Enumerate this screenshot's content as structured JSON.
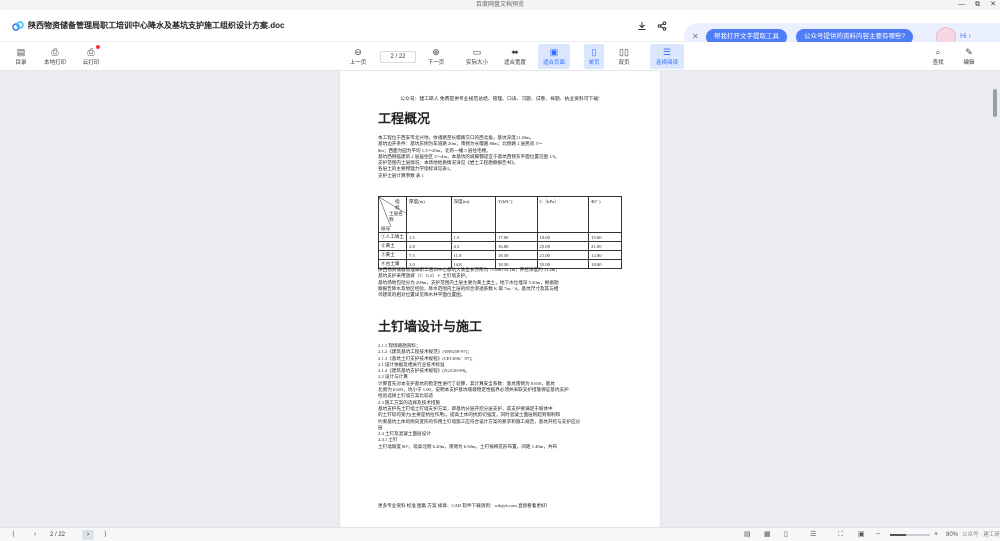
{
  "window": {
    "title": "百度网盘文档预览",
    "controls": [
      "—",
      "⧉",
      "✕"
    ]
  },
  "header": {
    "doc_title": "陕西物资储备管理局职工培训中心降水及基坑支护施工组织设计方案.doc",
    "assistant": {
      "pill1": "帮我打开文字提取工具",
      "pill2": "公众号提供的资料内容主要有哪些?",
      "hi": "Hi ›"
    }
  },
  "toolbar": {
    "catalog": "目录",
    "local_print": "本地打印",
    "cloud_print": "云打印",
    "prev_page": "上一页",
    "page_indicator": "2 / 22",
    "next_page": "下一页",
    "actual_size": "实际大小",
    "fit_width": "适合宽度",
    "fit_page": "适合页面",
    "single_page": "单页",
    "double_page": "双页",
    "continuous": "连续阅读",
    "find": "查找",
    "edit": "编辑"
  },
  "document": {
    "header_note": "公众号：建工研人  免费提供专业规范总结、管理、口诀、习题、试卷、样题、执业资料可下载!",
    "section1_title": "工程概况",
    "section1_paras": [
      "本工程位于西安市北兴地，依诸路至长缨路交口的西北角，基坑深度11.20m。",
      "基坑边开条件：基坑东侧为车道路 20m；南侧为长缨路 80m；北侧路 2 层民房 5～",
      "8m；西面为园为平均 1.5～20m，北有一幢 5 层住宅楼。",
      "基坑西侧临建筑 2 层居住区 3～4m，本基坑的坡脚都适宜于基坑西侧东平面位置见图 1/5。",
      "支护范围内土层情况：本场地地质情况详见《岩土工程勘察报告书》。",
      "各层土的主要物理力学指标详见表1。",
      "支护土层计算参数 表 1"
    ],
    "table": {
      "header": [
        "层号",
        "厚度(m)",
        "深度(m)",
        "Y(kN/  )",
        "C（kPa）",
        "Φ(°  )"
      ],
      "header_diag_top": "指标",
      "header_diag_mid": "土层名称",
      "rows": [
        [
          "①人工填土",
          "1.5",
          "1.5",
          "17.00",
          "10.00",
          "15.00"
        ],
        [
          "②黄土",
          "2.8",
          "4.3",
          "16.80",
          "25.00",
          "21.00"
        ],
        [
          "③黄土",
          "7.5",
          "11.8",
          "18.50",
          "21.00",
          "12.00"
        ],
        [
          "④古土壤",
          "3.0",
          "14.8",
          "18.50",
          "35.00",
          "18.00"
        ]
      ]
    },
    "after_table_paras": [
      "陕西物资储备管理局职工培训中心基坑大致呈长方形为 71.6m×33.1m，开挖深度约 11.2m；",
      "基坑支护采用放坡（1：0.2）＋ 土钉墙支护。",
      "基坑场地包括分为 209m，支护范围内土层主要为黄土类土，地下水位埋深 5.50m，根据勘",
      "察报告降水及地区经验，降水范围内土层的综合渗透系数 K 取 7m／d，基坑尺寸及其与相",
      "邻建筑的相对位置详见降水井平面位置图。"
    ],
    "section2_title": "土钉墙设计与施工",
    "section2_paras": [
      "2.1.1 现场踏勘资料；",
      "2.1.2《建筑基坑工程技术规范》(YB9258-97)；",
      "2.1.3《基坑土钉支护技术规程》(CECS96：97)；",
      "2.1 设计依据及相关行业技术标准",
      "2.1.4《建筑基坑支护技术规程》(JGJ120-99)。",
      "2.2 设计与计算",
      "计算首先对本支护基坑的稳定性进行了验算，其计算安全系数：基坑南侧为 0.650，基坑",
      "北侧为 0.603，坑小于 1.00，说明本支护基坑坡坡稳定性临界必须并采取支护措施保证基坑支护",
      "经验选择土钉墙方案比较适",
      "2.3 施工方案的选择及技术措施",
      "基坑支护先土钉墙土钉墙支护方案，即基坑分层开挖分层支护，其支护要满足于坡体中",
      "的土钉较均受力(主要是抗拉作用)，提高土体的抗剪切强度，同时混凝土面层则起到限制和",
      "约束基坑土体的侧向变形的作用土钉墙施工应符合设计方案的要求和施工规范，基坑开挖与支护应分",
      "层",
      "2.4 土钉及混凝土面层设计",
      "2.4.1 土钉",
      "土钉墙坡度 80°，墙高北侧 6.20m，南侧为 6.50m，土钉按梅花形布置，间距 1.40m，共布"
    ],
    "footer_note": "更多专业资料 标准 图集 方案 规章、CAD 软件下载请到：wdsjyb.com 直接看着更好！"
  },
  "statusbar": {
    "first": "⟨",
    "prev": "‹",
    "page": "2 / 22",
    "next": "›",
    "last": "⟩",
    "zoom_label": "80%",
    "zoom_percent": 80,
    "watermark": "公众号 · 建工研人"
  }
}
